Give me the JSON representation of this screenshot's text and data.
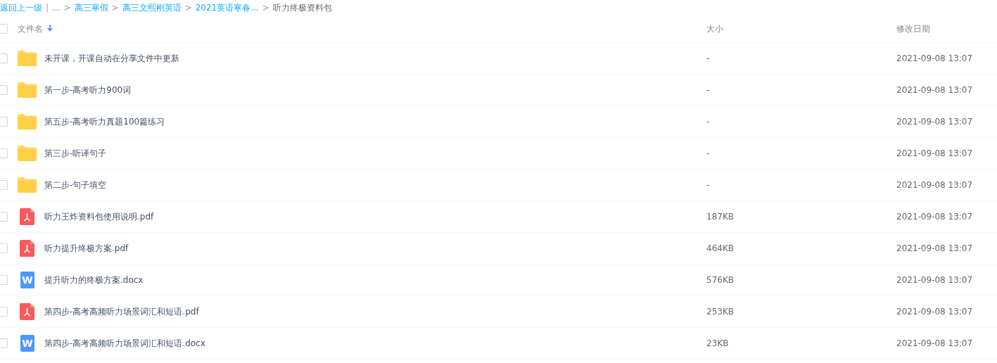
{
  "breadcrumb": {
    "back": "返回上一级",
    "divider": "|",
    "ellipsis": "...",
    "separator": ">",
    "links": [
      "高三寒假",
      "高三文熙刚英语",
      "2021英语寒春..."
    ],
    "current": "听力终极资料包"
  },
  "table": {
    "columns": [
      {
        "label": "文件名",
        "sorted": true
      },
      {
        "label": "大小",
        "sorted": false
      },
      {
        "label": "修改日期",
        "sorted": false
      }
    ],
    "header_checked": false,
    "rows": [
      {
        "kind": "folder",
        "name": "未开课，开课自动在分享文件中更新",
        "size": "-",
        "date": "2021-09-08 13:07",
        "checked": false
      },
      {
        "kind": "folder",
        "name": "第一步-高考听力900词",
        "size": "-",
        "date": "2021-09-08 13:07",
        "checked": false
      },
      {
        "kind": "folder",
        "name": "第五步-高考听力真题100篇练习",
        "size": "-",
        "date": "2021-09-08 13:07",
        "checked": false
      },
      {
        "kind": "folder",
        "name": "第三步-听译句子",
        "size": "-",
        "date": "2021-09-08 13:07",
        "checked": false
      },
      {
        "kind": "folder",
        "name": "第二步-句子填空",
        "size": "-",
        "date": "2021-09-08 13:07",
        "checked": false
      },
      {
        "kind": "pdf",
        "name": "听力王炸资料包使用说明.pdf",
        "size": "187KB",
        "date": "2021-09-08 13:07",
        "checked": false
      },
      {
        "kind": "pdf",
        "name": "听力提升终极方案.pdf",
        "size": "464KB",
        "date": "2021-09-08 13:07",
        "checked": false
      },
      {
        "kind": "word",
        "icon_text": "W",
        "name": "提升听力的终极方案.docx",
        "size": "576KB",
        "date": "2021-09-08 13:07",
        "checked": false
      },
      {
        "kind": "pdf",
        "name": "第四步-高考高频听力场景词汇和短语.pdf",
        "size": "253KB",
        "date": "2021-09-08 13:07",
        "checked": false
      },
      {
        "kind": "word",
        "icon_text": "W",
        "name": "第四步-高考高频听力场景词汇和短语.docx",
        "size": "23KB",
        "date": "2021-09-08 13:07",
        "checked": false
      }
    ]
  }
}
